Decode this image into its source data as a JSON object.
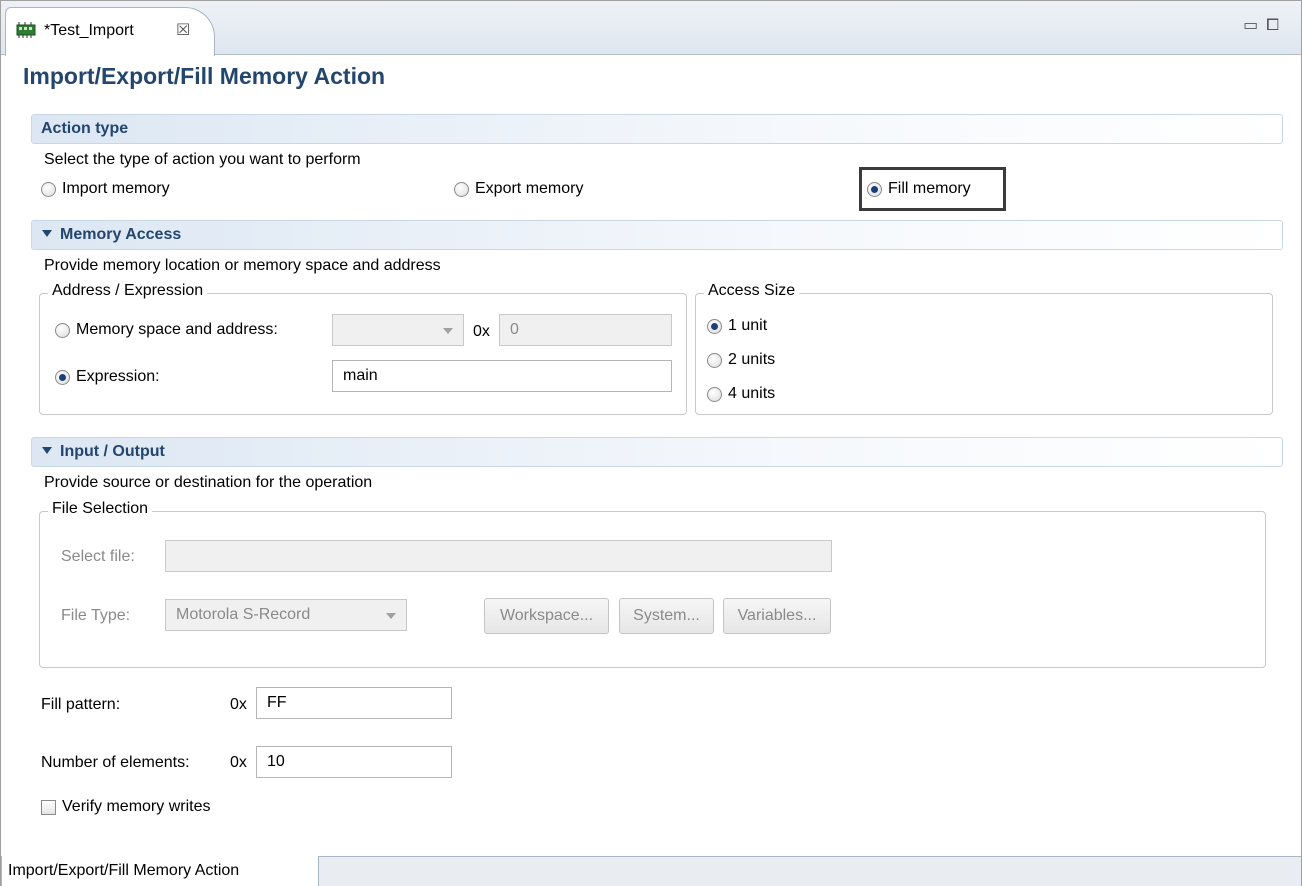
{
  "editor_tab": {
    "title": "*Test_Import",
    "close_glyph": "☒",
    "icon": "memory-chip-icon"
  },
  "window_controls": {
    "minimize": "▭",
    "maximize": "⧠"
  },
  "page_title": "Import/Export/Fill Memory Action",
  "action_type": {
    "header": "Action type",
    "description": "Select the type of action you want to perform",
    "options": [
      {
        "label": "Import memory",
        "selected": false
      },
      {
        "label": "Export memory",
        "selected": false
      },
      {
        "label": "Fill memory",
        "selected": true
      }
    ]
  },
  "memory_access": {
    "header": "Memory Access",
    "description": "Provide memory location or memory space and address",
    "address_group": {
      "legend": "Address / Expression",
      "space_radio": "Memory space and address:",
      "space_selected": false,
      "prefix": "0x",
      "address_value": "0",
      "expression_radio": "Expression:",
      "expression_selected": true,
      "expression_value": "main"
    },
    "access_size": {
      "legend": "Access Size",
      "options": [
        {
          "label": "1 unit",
          "selected": true
        },
        {
          "label": "2 units",
          "selected": false
        },
        {
          "label": "4 units",
          "selected": false
        }
      ]
    }
  },
  "input_output": {
    "header": "Input / Output",
    "description": "Provide source or destination for the operation",
    "file_selection": {
      "legend": "File Selection",
      "select_file_label": "Select file:",
      "select_file_value": "",
      "file_type_label": "File Type:",
      "file_type_value": "Motorola S-Record",
      "buttons": [
        "Workspace...",
        "System...",
        "Variables..."
      ]
    }
  },
  "fill_pattern": {
    "label": "Fill pattern:",
    "prefix": "0x",
    "value": "FF"
  },
  "number_of_elements": {
    "label": "Number of elements:",
    "prefix": "0x",
    "value": "10"
  },
  "verify": {
    "label": "Verify memory writes",
    "checked": false
  },
  "bottom_tab": "Import/Export/Fill Memory Action"
}
